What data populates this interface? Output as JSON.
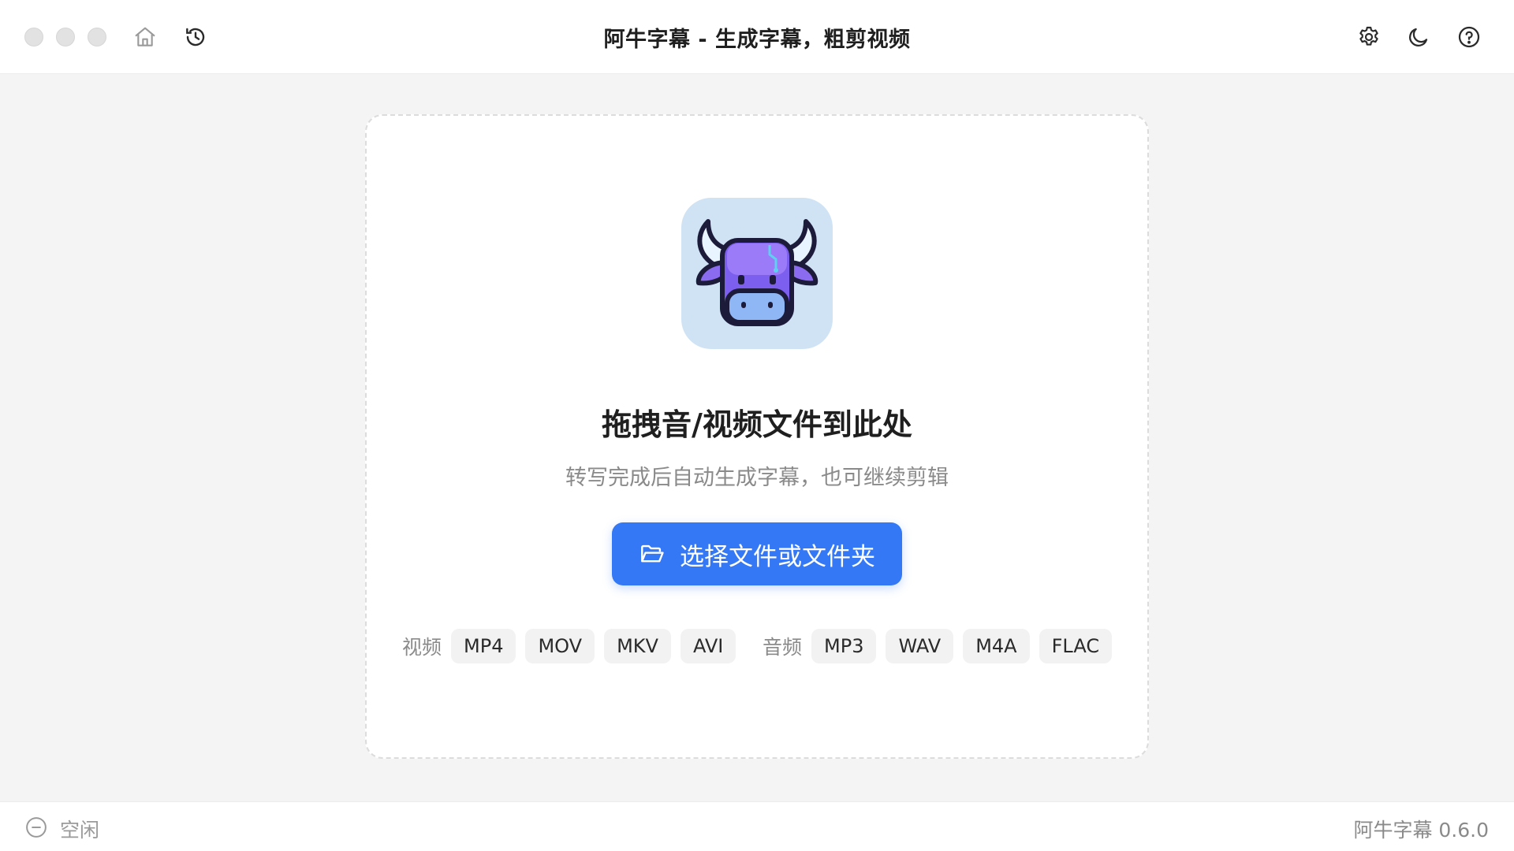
{
  "window": {
    "title": "阿牛字幕 - 生成字幕，粗剪视频"
  },
  "toolbar": {
    "left_icons": [
      "home-icon",
      "history-icon"
    ],
    "right_icons": [
      "gear-icon",
      "moon-icon",
      "help-icon"
    ]
  },
  "drop_zone": {
    "title": "拖拽音/视频文件到此处",
    "subtitle": "转写完成后自动生成字幕，也可继续剪辑",
    "button_label": "选择文件或文件夹",
    "button_icon": "folder-open-icon",
    "accent_color": "#3478f6"
  },
  "formats": {
    "video_label": "视频",
    "video": [
      "MP4",
      "MOV",
      "MKV",
      "AVI"
    ],
    "audio_label": "音频",
    "audio": [
      "MP3",
      "WAV",
      "M4A",
      "FLAC"
    ]
  },
  "status": {
    "icon": "minus-circle-icon",
    "text": "空闲",
    "version": "阿牛字幕 0.6.0"
  }
}
